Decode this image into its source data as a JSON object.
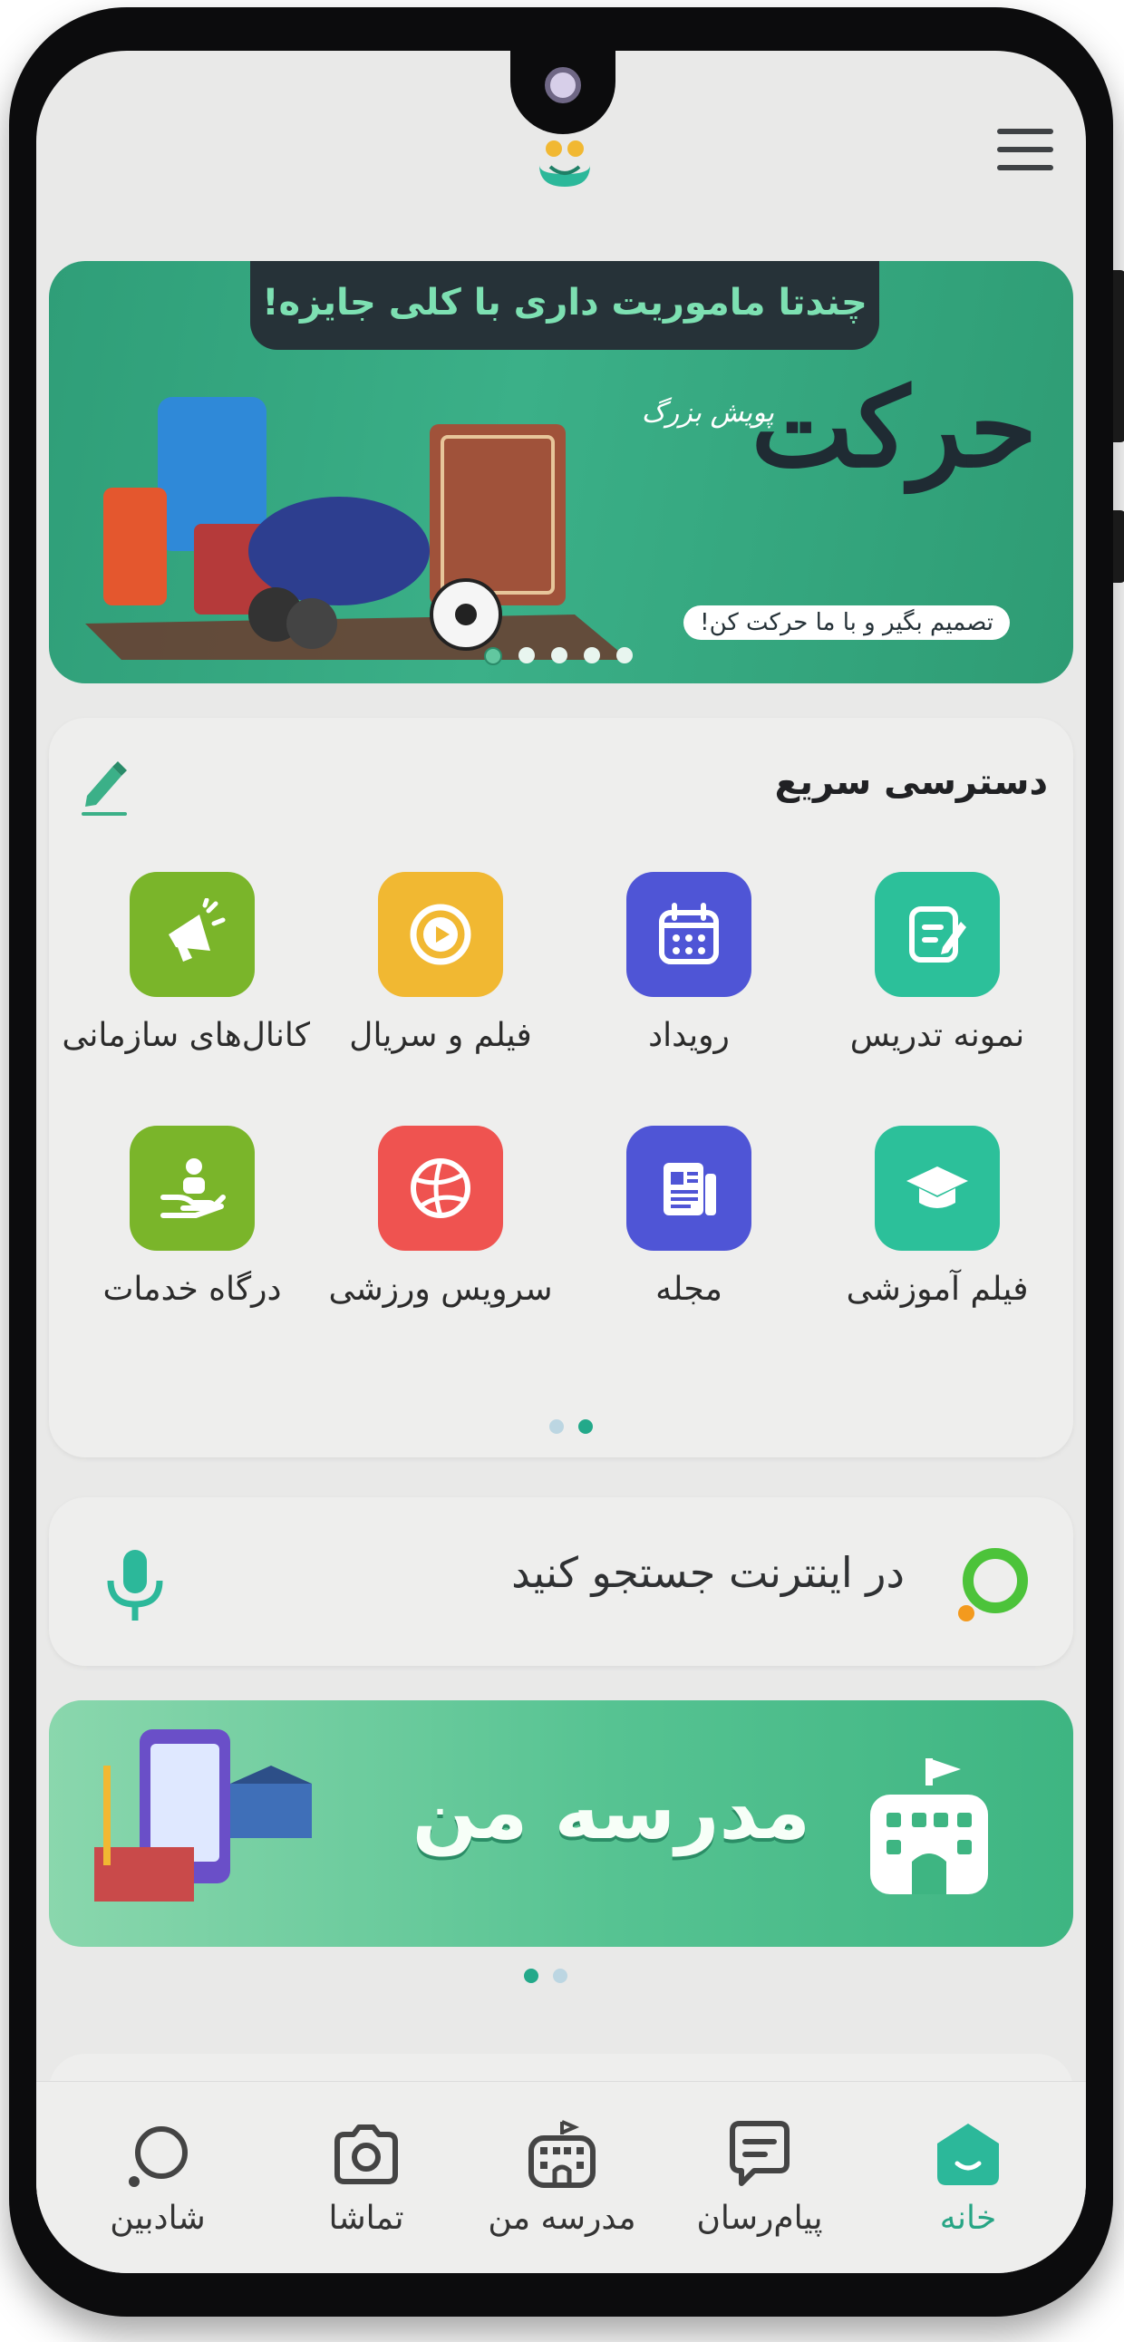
{
  "hero": {
    "headline": "چندتا ماموریت داری با کلی جایزه!",
    "title": "حرکت",
    "sub_title": "پویش بزرگ",
    "tagline": "تصمیم بگیر و با ما حرکت کن!",
    "slides": 5,
    "active_slide": 1,
    "color": "#3bb088"
  },
  "quick_access": {
    "title": "دسترسی سریع",
    "items": [
      {
        "label": "نمونه تدریس",
        "icon": "edit-note-icon",
        "color": "#2cc09a"
      },
      {
        "label": "رویداد",
        "icon": "calendar-icon",
        "color": "#4f55d6"
      },
      {
        "label": "فیلم و سریال",
        "icon": "play-icon",
        "color": "#f1b832"
      },
      {
        "label": "کانال‌های سازمانی",
        "icon": "megaphone-icon",
        "color": "#7ab52a"
      },
      {
        "label": "فیلم آموزشی",
        "icon": "graduation-cap-icon",
        "color": "#2cc09a"
      },
      {
        "label": "مجله",
        "icon": "newspaper-icon",
        "color": "#4f55d6"
      },
      {
        "label": "سرویس ورزشی",
        "icon": "volleyball-icon",
        "color": "#ef5350"
      },
      {
        "label": "درگاه خدمات",
        "icon": "service-hand-icon",
        "color": "#7ab52a"
      }
    ],
    "pages": 2,
    "active_page": 2
  },
  "search": {
    "placeholder": "در اینترنت جستجو کنید"
  },
  "school_banner": {
    "title": "مدرسه من",
    "pages": 2,
    "active_page": 1
  },
  "nav": {
    "items": [
      {
        "label": "خانه",
        "icon": "home-icon",
        "active": true
      },
      {
        "label": "پیام‌رسان",
        "icon": "chat-icon",
        "active": false
      },
      {
        "label": "مدرسه من",
        "icon": "school-icon",
        "active": false
      },
      {
        "label": "تماشا",
        "icon": "camera-icon",
        "active": false
      },
      {
        "label": "شادبین",
        "icon": "search-icon",
        "active": false
      }
    ]
  },
  "colors": {
    "accent": "#27a585",
    "background": "#e9e9e8"
  }
}
